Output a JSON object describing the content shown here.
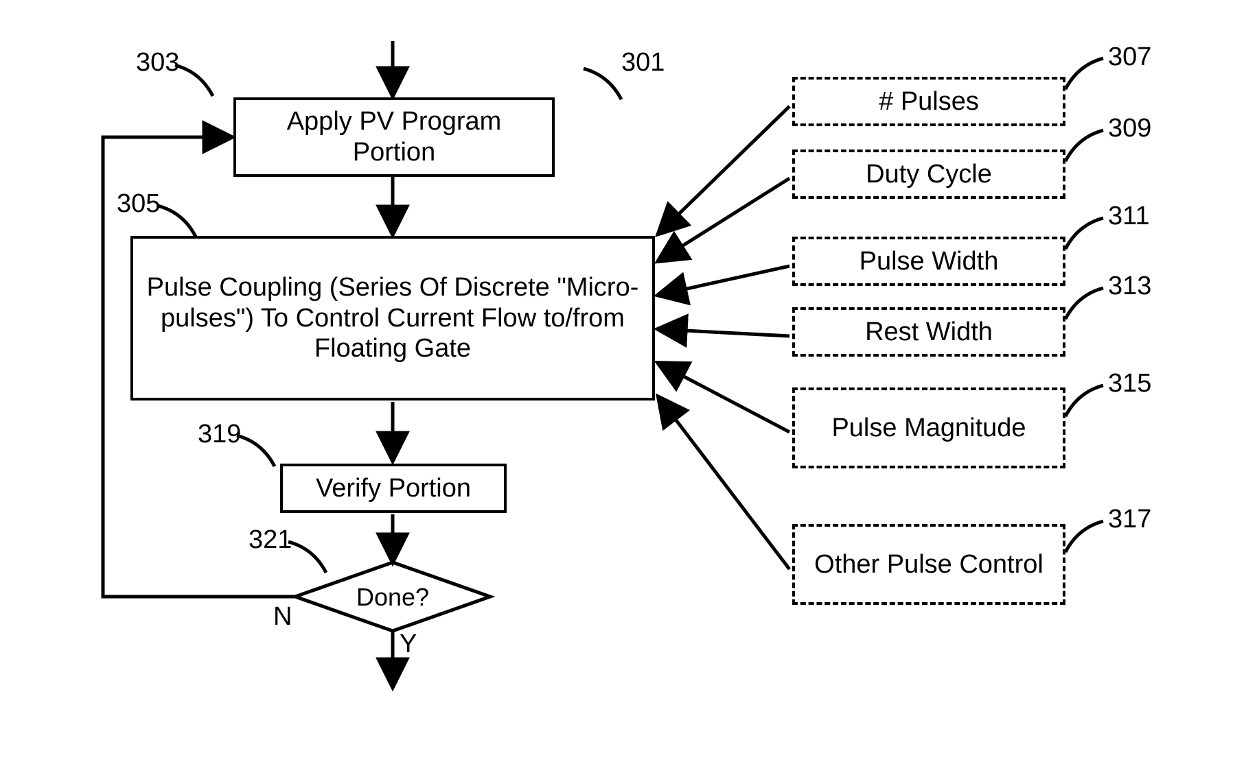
{
  "refs": {
    "r301": "301",
    "r303": "303",
    "r305": "305",
    "r307": "307",
    "r309": "309",
    "r311": "311",
    "r313": "313",
    "r315": "315",
    "r317": "317",
    "r319": "319",
    "r321": "321"
  },
  "boxes": {
    "b303": "Apply PV Program Portion",
    "b305": "Pulse Coupling (Series Of Discrete \"Micro-pulses\") To Control Current Flow to/from Floating Gate",
    "b319": "Verify Portion",
    "b307": "# Pulses",
    "b309": "Duty Cycle",
    "b311": "Pulse Width",
    "b313": "Rest Width",
    "b315": "Pulse Magnitude",
    "b317": "Other Pulse Control"
  },
  "decision": {
    "d321": "Done?",
    "no": "N",
    "yes": "Y"
  }
}
